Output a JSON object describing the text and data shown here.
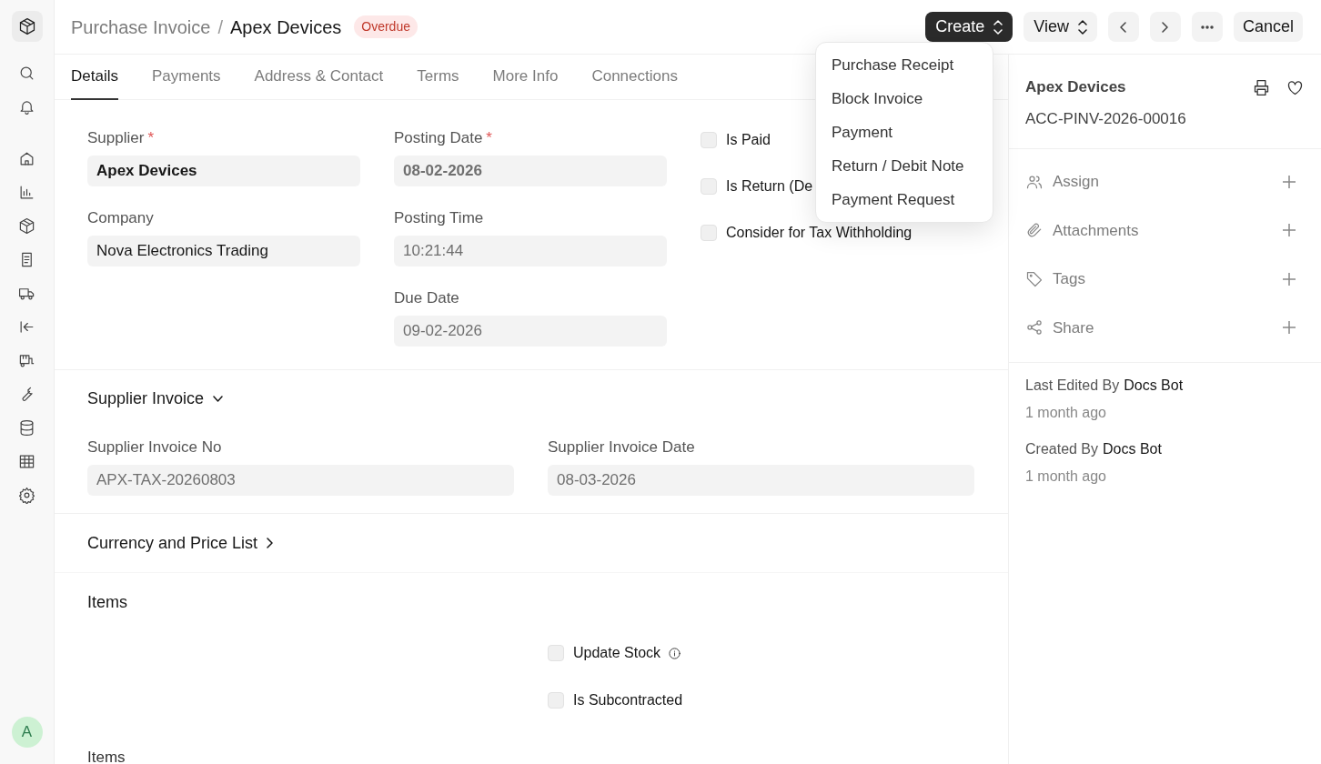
{
  "sidebar": {
    "avatar": "A"
  },
  "header": {
    "breadcrumb": "Purchase Invoice",
    "separator": "/",
    "title": "Apex Devices",
    "badge": "Overdue"
  },
  "actions": [
    {
      "kind": "primary",
      "label": "Create"
    },
    {
      "kind": "select",
      "label": "View"
    },
    {
      "kind": "prev"
    },
    {
      "kind": "next"
    },
    {
      "kind": "more"
    },
    {
      "kind": "plain",
      "label": "Cancel"
    }
  ],
  "create_menu": {
    "open": true,
    "items": [
      "Purchase Receipt",
      "Block Invoice",
      "Payment",
      "Return / Debit Note",
      "Payment Request"
    ]
  },
  "tabs": [
    {
      "label": "Details",
      "selected": true
    },
    {
      "label": "Payments",
      "selected": false
    },
    {
      "label": "Address & Contact",
      "selected": false
    },
    {
      "label": "Terms",
      "selected": false
    },
    {
      "label": "More Info",
      "selected": false
    },
    {
      "label": "Connections",
      "selected": false
    }
  ],
  "details": {
    "required_mark": "*",
    "columns": [
      [
        {
          "label": "Supplier",
          "required": true,
          "value": "Apex Devices",
          "bold": true,
          "read_only": false
        },
        {
          "label": "Company",
          "required": false,
          "value": "Nova Electronics Trading",
          "bold": false,
          "read_only": false
        }
      ],
      [
        {
          "label": "Posting Date",
          "required": true,
          "value": "08-02-2026",
          "bold": true,
          "read_only": true
        },
        {
          "label": "Posting Time",
          "required": false,
          "value": "10:21:44",
          "bold": false,
          "read_only": true
        },
        {
          "label": "Due Date",
          "required": false,
          "value": "09-02-2026",
          "bold": false,
          "read_only": true
        }
      ]
    ],
    "checks": [
      {
        "label": "Is Paid",
        "checked": false
      },
      {
        "label": "Is Return (De",
        "checked": false
      },
      {
        "label": "Consider for Tax Withholding",
        "checked": false
      }
    ]
  },
  "supplier_invoice": {
    "title": "Supplier Invoice",
    "expanded": true,
    "fields": [
      {
        "label": "Supplier Invoice No",
        "value": "APX-TAX-20260803",
        "read_only": true
      },
      {
        "label": "Supplier Invoice Date",
        "value": "08-03-2026",
        "read_only": true
      }
    ]
  },
  "currency_section": {
    "title": "Currency and Price List",
    "expanded": false
  },
  "items_section": {
    "title": "Items",
    "checks": [
      {
        "label": "Update Stock",
        "checked": false,
        "info": true
      },
      {
        "label": "Is Subcontracted",
        "checked": false,
        "info": false
      }
    ],
    "table_label": "Items"
  },
  "side_panel": {
    "title": "Apex Devices",
    "doc_id": "ACC-PINV-2026-00016",
    "attributes": [
      {
        "kind": "assign",
        "label": "Assign"
      },
      {
        "kind": "attachments",
        "label": "Attachments"
      },
      {
        "kind": "tags",
        "label": "Tags"
      },
      {
        "kind": "share",
        "label": "Share"
      }
    ],
    "activity": [
      {
        "label": "Last Edited By",
        "user": "Docs Bot",
        "time": "1 month ago"
      },
      {
        "label": "Created By",
        "user": "Docs Bot",
        "time": "1 month ago"
      }
    ]
  }
}
